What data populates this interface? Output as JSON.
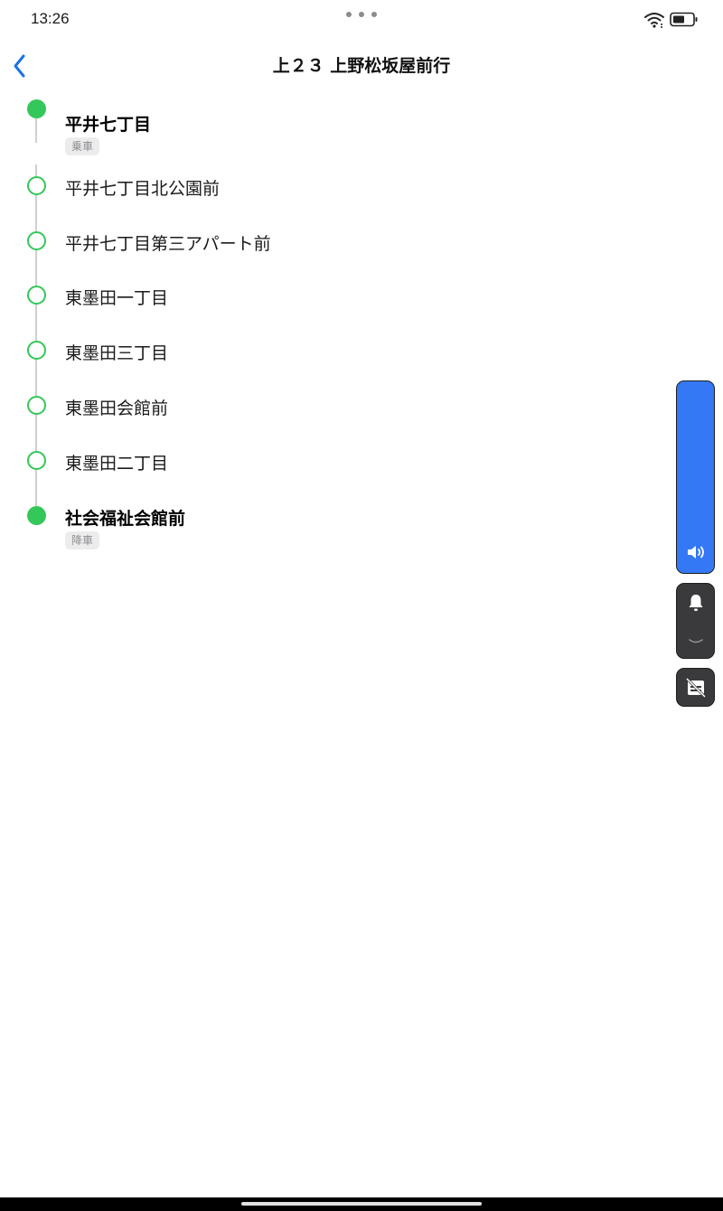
{
  "status_bar": {
    "time": "13:26"
  },
  "header": {
    "title": "上２３ 上野松坂屋前行"
  },
  "stops": [
    {
      "name": "平井七丁目",
      "tag": "乗車",
      "kind": "endpoint"
    },
    {
      "name": "平井七丁目北公園前",
      "kind": "intermediate"
    },
    {
      "name": "平井七丁目第三アパート前",
      "kind": "intermediate"
    },
    {
      "name": "東墨田一丁目",
      "kind": "intermediate"
    },
    {
      "name": "東墨田三丁目",
      "kind": "intermediate"
    },
    {
      "name": "東墨田会館前",
      "kind": "intermediate"
    },
    {
      "name": "東墨田二丁目",
      "kind": "intermediate"
    },
    {
      "name": "社会福祉会館前",
      "tag": "降車",
      "kind": "endpoint"
    }
  ],
  "controls": {
    "volume_icon": "speaker-icon",
    "ring_icon": "bell-icon",
    "expand_icon": "chevron-down-icon",
    "caption_icon": "captions-off-icon"
  },
  "colors": {
    "accent_green": "#34c759",
    "volume_blue": "#3478f6",
    "back_blue": "#1a73e8",
    "dark_control": "#3a3a3c"
  }
}
